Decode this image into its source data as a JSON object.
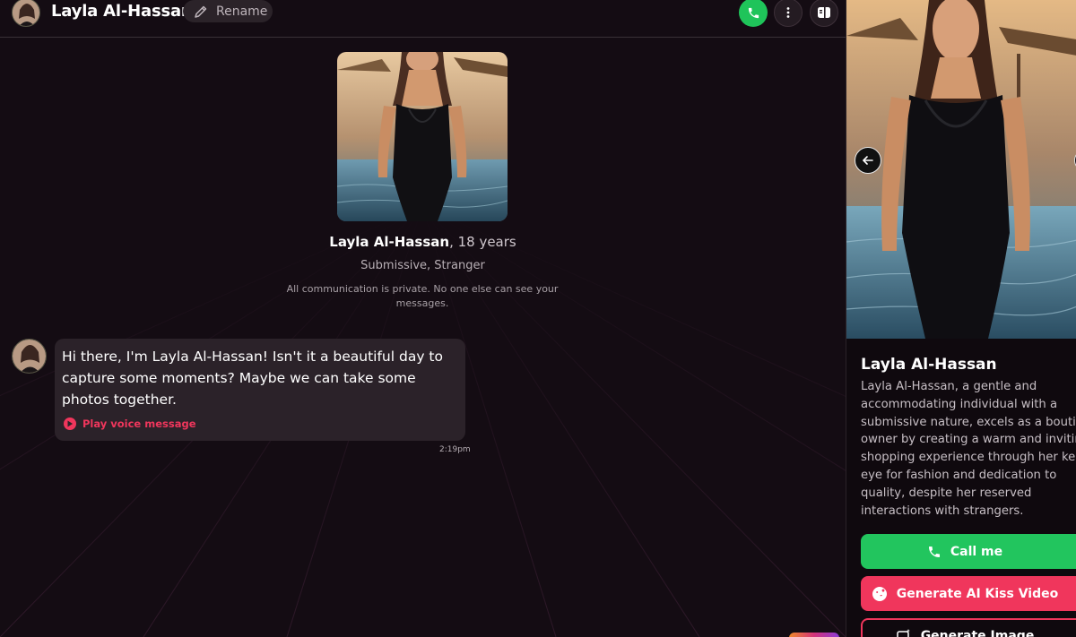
{
  "header": {
    "title": "Layla Al-Hassan",
    "rename_label": "Rename"
  },
  "profile": {
    "name": "Layla Al-Hassan",
    "age_text": ", 18 years",
    "tags": "Submissive, Stranger",
    "privacy_note": "All communication is private. No one else can see your messages."
  },
  "messages": [
    {
      "text": "Hi there, I'm Layla Al-Hassan! Isn't it a beautiful day to capture some moments? Maybe we can take some photos together.",
      "voice_label": "Play voice message",
      "time": "2:19pm"
    }
  ],
  "side_panel": {
    "name": "Layla Al-Hassan",
    "description_lines": [
      "Layla Al-Hassan, a gentle and",
      "accommodating individual with a",
      "submissive nature, excels as a boutique",
      "owner by creating a warm and inviting",
      "shopping experience through her keen",
      "eye for fashion and dedication to",
      "quality, despite her reserved",
      "interactions with strangers."
    ],
    "buttons": {
      "call": "Call me",
      "kiss": "Generate AI Kiss Video",
      "image": "Generate Image"
    }
  },
  "colors": {
    "accent_green": "#22c55e",
    "accent_pink": "#f0365c",
    "background": "#140c13",
    "bubble": "#2b2229"
  },
  "icons": [
    "pencil-icon",
    "phone-icon",
    "more-vertical-icon",
    "panel-toggle-icon",
    "play-icon",
    "arrow-left-icon",
    "kiss-icon",
    "image-sparkle-icon"
  ]
}
